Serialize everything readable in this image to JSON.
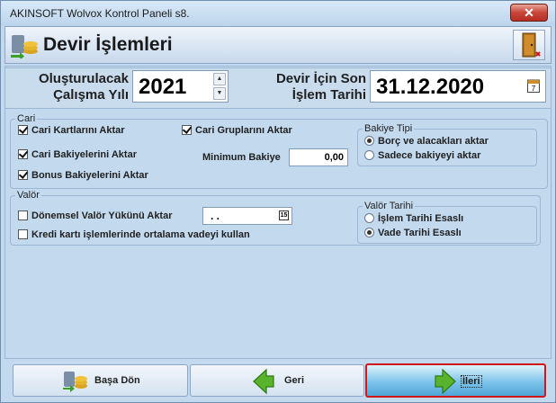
{
  "window": {
    "title": "AKINSOFT Wolvox Kontrol Paneli s8.",
    "close_label": "✕"
  },
  "header": {
    "title": "Devir İşlemleri",
    "icon": "coins-transfer-icon",
    "exit_icon": "door-exit-icon"
  },
  "top": {
    "year_label_line1": "Oluşturulacak",
    "year_label_line2": "Çalışma Yılı",
    "year_value": "2021",
    "date_label_line1": "Devir İçin Son",
    "date_label_line2": "İşlem Tarihi",
    "date_value": "31.12.2020",
    "calendar_icon_text": "7"
  },
  "cari": {
    "legend": "Cari",
    "cari_kartlari": {
      "label": "Cari Kartlarını Aktar",
      "checked": true
    },
    "cari_gruplari": {
      "label": "Cari Gruplarını Aktar",
      "checked": true
    },
    "cari_bakiyeleri": {
      "label": "Cari Bakiyelerini Aktar",
      "checked": true
    },
    "bonus_bakiyeleri": {
      "label": "Bonus Bakiyelerini Aktar",
      "checked": true
    },
    "minimum_bakiye_label": "Minimum Bakiye",
    "minimum_bakiye_value": "0,00",
    "bakiye_tipi": {
      "legend": "Bakiye Tipi",
      "option1": "Borç ve alacakları aktar",
      "option2": "Sadece bakiyeyi aktar",
      "selected": 1
    }
  },
  "valor": {
    "legend": "Valör",
    "donemsel": {
      "label": "Dönemsel Valör Yükünü Aktar",
      "checked": false
    },
    "kredi": {
      "label": "Kredi kartı işlemlerinde ortalama vadeyi kullan",
      "checked": false
    },
    "date_input_value": ". .",
    "date_input_icon_text": "15",
    "valor_tarihi": {
      "legend": "Valör Tarihi",
      "option1": "İşlem Tarihi Esaslı",
      "option2": "Vade Tarihi Esaslı",
      "selected": 2
    }
  },
  "footer": {
    "basa_don": "Başa Dön",
    "geri": "Geri",
    "ileri": "İleri"
  },
  "colors": {
    "highlight_border": "#d01818",
    "accent_blue": "#4ea6d9"
  }
}
